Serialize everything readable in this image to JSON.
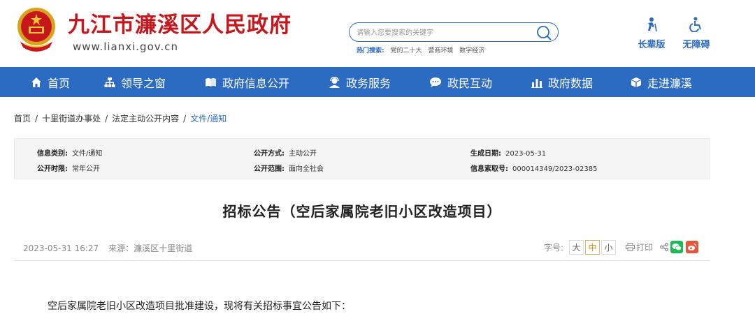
{
  "header": {
    "site_title": "九江市濂溪区人民政府",
    "site_url": "www.lianxi.gov.cn",
    "search": {
      "placeholder": "请输入您要搜索的关键字",
      "hot_label": "热门搜索:",
      "hot_items": [
        "党的二十大",
        "营商环境",
        "数字经济"
      ]
    },
    "quick_links": [
      {
        "label": "长辈版",
        "icon": "elder-icon"
      },
      {
        "label": "无障碍",
        "icon": "wheelchair-icon"
      }
    ]
  },
  "nav": {
    "items": [
      {
        "label": "首页",
        "icon": "home-icon"
      },
      {
        "label": "领导之窗",
        "icon": "org-chart-icon"
      },
      {
        "label": "政府信息公开",
        "icon": "book-icon"
      },
      {
        "label": "政务服务",
        "icon": "user-service-icon"
      },
      {
        "label": "政民互动",
        "icon": "chat-icon"
      },
      {
        "label": "政府数据",
        "icon": "bar-chart-icon"
      },
      {
        "label": "走进濂溪",
        "icon": "box-icon"
      }
    ]
  },
  "breadcrumb": {
    "items": [
      "首页",
      "十里街道办事处",
      "法定主动公开内容",
      "文件/通知"
    ],
    "separator": "/"
  },
  "info": {
    "category_label": "信息类别:",
    "category_value": "文件/通知",
    "method_label": "公开方式:",
    "method_value": "主动公开",
    "date_label": "生成日期:",
    "date_value": "2023-05-31",
    "period_label": "公开时限:",
    "period_value": "常年公开",
    "scope_label": "公开范围:",
    "scope_value": "面向全社会",
    "index_label": "信息索取号:",
    "index_value": "000014349/2023-02385"
  },
  "article": {
    "title": "招标公告（空后家属院老旧小区改造项目）",
    "datetime": "2023-05-31 16:27",
    "source": "来源：濂溪区十里街道",
    "font_size_label": "字号:",
    "font_sizes": [
      "大",
      "中",
      "小"
    ],
    "print_label": "打印",
    "body_first_line": "空后家属院老旧小区改造项目批准建设，现将有关招标事宜公告如下："
  },
  "colors": {
    "brand_red": "#c8161d",
    "nav_blue": "#2c6bc2",
    "wechat_green": "#1db954",
    "weibo_red": "#e6553a"
  }
}
